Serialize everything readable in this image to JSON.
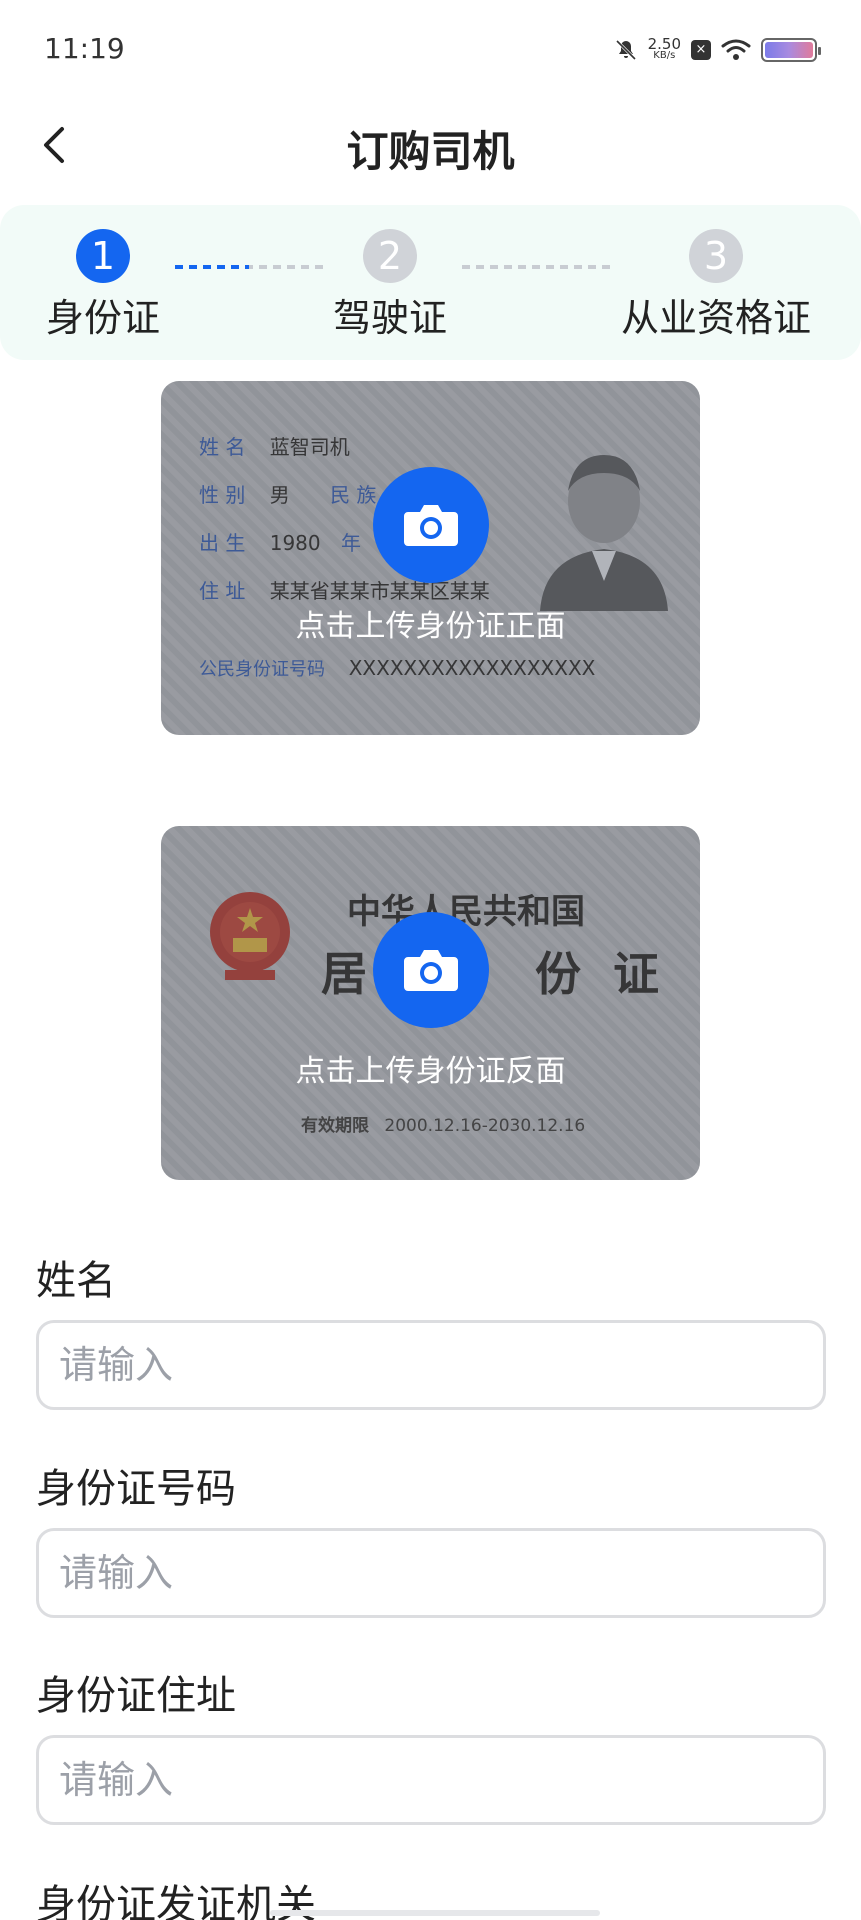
{
  "status_bar": {
    "time": "11:19",
    "net_speed_value": "2.50",
    "net_speed_unit": "KB/s",
    "icons": [
      "mute-bell-icon",
      "x-box-icon",
      "wifi-icon",
      "battery-icon"
    ]
  },
  "nav": {
    "title": "订购司机",
    "back_icon": "chevron-left-icon"
  },
  "steps": [
    {
      "number": "1",
      "label": "身份证",
      "active": true
    },
    {
      "number": "2",
      "label": "驾驶证",
      "active": false
    },
    {
      "number": "3",
      "label": "从业资格证",
      "active": false
    }
  ],
  "id_front": {
    "name_key": "姓 名",
    "name_val": "蓝智司机",
    "gender_key": "性 别",
    "gender_val": "男",
    "ethnic_key": "民 族",
    "birth_key": "出 生",
    "birth_val": "1980",
    "birth_year_unit": "年",
    "address_key": "住 址",
    "address_val": "某某省某某市某某区某某",
    "id_key": "公民身份证号码",
    "id_val": "XXXXXXXXXXXXXXXXXX",
    "upload_label": "点击上传身份证正面"
  },
  "id_back": {
    "title1": "中华人民共和国",
    "title2_left": "居",
    "title2_right": "份 证",
    "valid_key": "有效期限",
    "valid_val": "2000.12.16-2030.12.16",
    "upload_label": "点击上传身份证反面"
  },
  "form": {
    "fields": [
      {
        "label": "姓名",
        "placeholder": "请输入"
      },
      {
        "label": "身份证号码",
        "placeholder": "请输入"
      },
      {
        "label": "身份证住址",
        "placeholder": "请输入"
      },
      {
        "label": "身份证发证机关"
      }
    ]
  },
  "colors": {
    "primary": "#1466f0",
    "step_inactive": "#d0d3d8",
    "steps_bg": "#f2fbf8",
    "input_border": "#dcdde0",
    "placeholder": "#9ca0a8"
  }
}
